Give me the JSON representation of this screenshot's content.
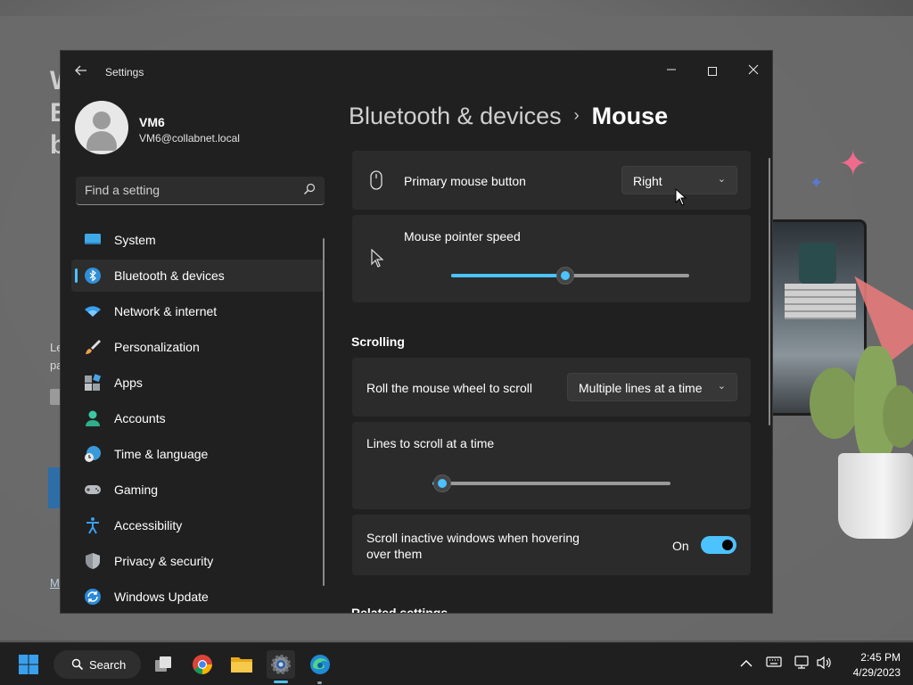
{
  "app": {
    "title": "Settings"
  },
  "profile": {
    "name": "VM6",
    "email": "VM6@collabnet.local"
  },
  "search": {
    "placeholder": "Find a setting"
  },
  "sidebar": {
    "items": [
      {
        "label": "System",
        "icon": "monitor-icon",
        "active": false
      },
      {
        "label": "Bluetooth & devices",
        "icon": "bluetooth-icon",
        "active": true
      },
      {
        "label": "Network & internet",
        "icon": "wifi-icon",
        "active": false
      },
      {
        "label": "Personalization",
        "icon": "brush-icon",
        "active": false
      },
      {
        "label": "Apps",
        "icon": "apps-icon",
        "active": false
      },
      {
        "label": "Accounts",
        "icon": "person-icon",
        "active": false
      },
      {
        "label": "Time & language",
        "icon": "clock-globe-icon",
        "active": false
      },
      {
        "label": "Gaming",
        "icon": "gamepad-icon",
        "active": false
      },
      {
        "label": "Accessibility",
        "icon": "accessibility-icon",
        "active": false
      },
      {
        "label": "Privacy & security",
        "icon": "shield-icon",
        "active": false
      },
      {
        "label": "Windows Update",
        "icon": "update-icon",
        "active": false
      }
    ]
  },
  "breadcrumb": {
    "parent": "Bluetooth & devices",
    "separator": "›",
    "current": "Mouse"
  },
  "mouse": {
    "primary_button": {
      "label": "Primary mouse button",
      "value": "Right"
    },
    "pointer_speed": {
      "label": "Mouse pointer speed",
      "value_fraction": 0.48
    }
  },
  "scrolling": {
    "heading": "Scrolling",
    "wheel": {
      "label": "Roll the mouse wheel to scroll",
      "value": "Multiple lines at a time"
    },
    "lines": {
      "label": "Lines to scroll at a time",
      "value_fraction": 0.04
    },
    "inactive": {
      "label_line1": "Scroll inactive windows when hovering",
      "label_line2": "over them",
      "state": "On",
      "enabled": true
    }
  },
  "related": {
    "heading": "Related settings"
  },
  "taskbar": {
    "search_label": "Search",
    "time": "2:45 PM",
    "date": "4/29/2023",
    "apps": [
      "start-icon",
      "search-icon",
      "task-view-icon",
      "chrome-icon",
      "file-explorer-icon",
      "settings-icon",
      "edge-icon"
    ]
  },
  "colors": {
    "accent": "#4cc2ff",
    "window_bg": "#202020",
    "card_bg": "#2b2b2b"
  }
}
